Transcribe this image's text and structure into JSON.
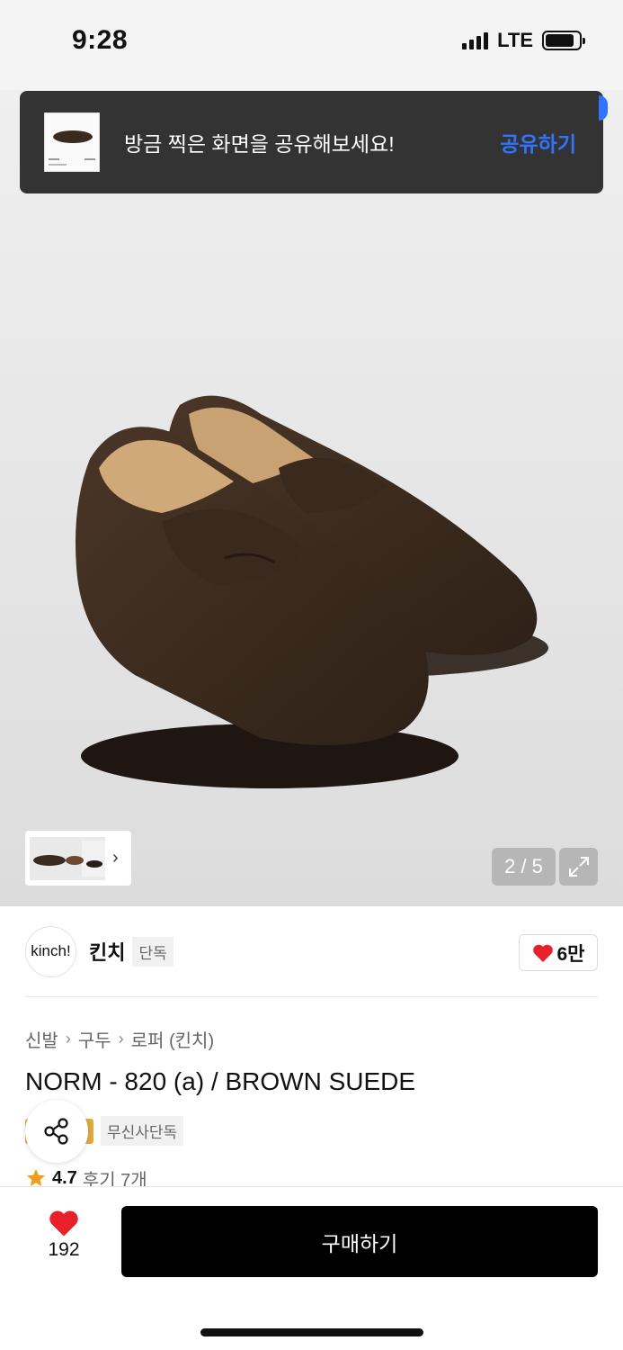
{
  "status_bar": {
    "time": "9:28",
    "network": "LTE"
  },
  "toast": {
    "message": "방금 찍은 화면을 공유해보세요!",
    "action": "공유하기"
  },
  "gallery": {
    "counter": "2 / 5"
  },
  "brand": {
    "logo_text": "kinch!",
    "name": "킨치",
    "tag": "단독",
    "likes": "6만"
  },
  "breadcrumb": [
    "신발",
    "구두",
    "로퍼 (킨치)"
  ],
  "product": {
    "title": "NORM - 820 (a) / BROWN SUEDE",
    "badge": "무신사단독",
    "rating": "4.7",
    "reviews": "후기 7개"
  },
  "bottom_bar": {
    "wish_count": "192",
    "buy_label": "구매하기"
  },
  "colors": {
    "accent_blue": "#2f74ff",
    "heart_red": "#e8202a",
    "toast_bg": "#333333",
    "suede_brown": "#3b2a1e",
    "star": "#f39b1b"
  },
  "icons": [
    "signal-icon",
    "battery-icon",
    "chevron-right-icon",
    "expand-icon",
    "heart-icon",
    "share-icon",
    "star-icon"
  ]
}
